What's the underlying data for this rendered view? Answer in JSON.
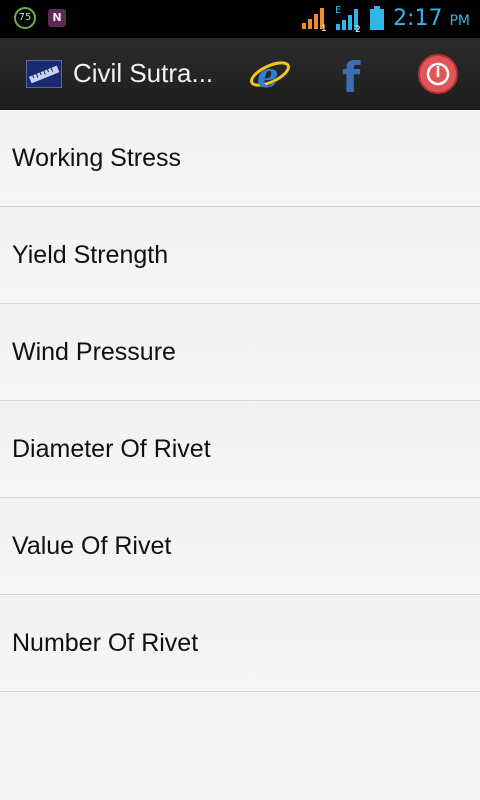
{
  "status_bar": {
    "battery_badge": "75",
    "notification_badge": "N",
    "network_type": "E",
    "sim1": "1",
    "sim2": "2",
    "time": "2:17",
    "ampm": "PM"
  },
  "action_bar": {
    "title": "Civil Sutra...",
    "icons": [
      "ruler-icon",
      "internet-explorer-icon",
      "facebook-icon",
      "power-icon"
    ]
  },
  "list": {
    "items": [
      {
        "label": "Working Stress"
      },
      {
        "label": "Yield Strength"
      },
      {
        "label": "Wind Pressure"
      },
      {
        "label": "Diameter Of Rivet"
      },
      {
        "label": "Value Of Rivet"
      },
      {
        "label": "Number Of Rivet"
      }
    ]
  },
  "colors": {
    "status_accent": "#33b5e5",
    "actionbar_bg": "#222222",
    "list_bg": "#f4f4f4"
  }
}
